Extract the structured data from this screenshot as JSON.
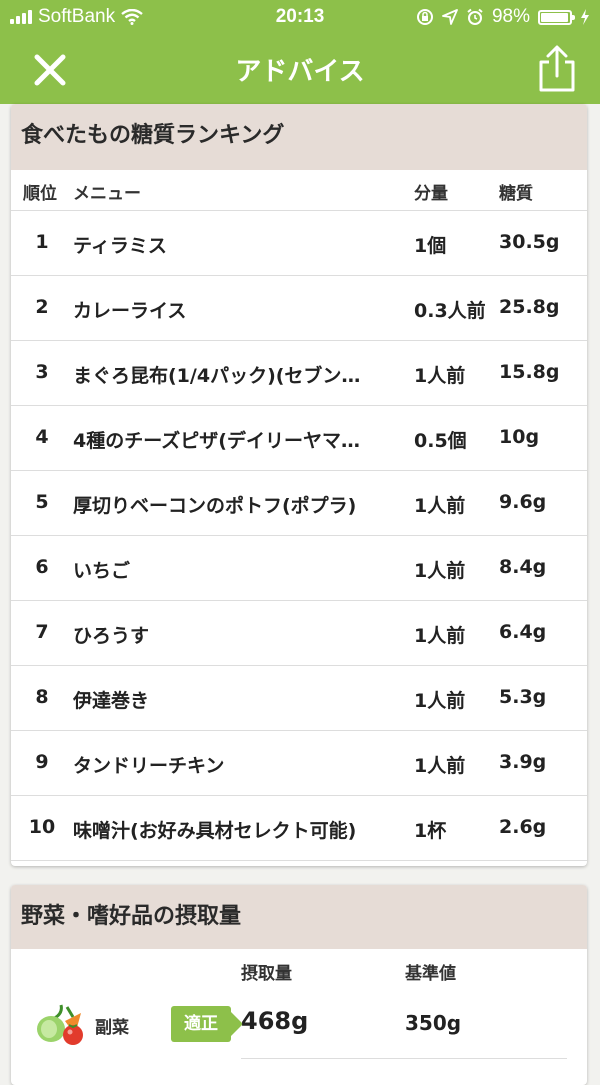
{
  "status": {
    "carrier": "SoftBank",
    "time": "20:13",
    "battery_text": "98%",
    "battery_level": 0.98
  },
  "nav": {
    "title": "アドバイス",
    "close_icon": "close-icon",
    "share_icon": "share-icon"
  },
  "ranking": {
    "title": "食べたもの糖質ランキング",
    "headers": {
      "rank": "順位",
      "menu": "メニュー",
      "qty": "分量",
      "carb": "糖質"
    },
    "rows": [
      {
        "rank": "1",
        "menu": "ティラミス",
        "qty": "1個",
        "carb": "30.5g"
      },
      {
        "rank": "2",
        "menu": "カレーライス",
        "qty": "0.3人前",
        "carb": "25.8g"
      },
      {
        "rank": "3",
        "menu": "まぐろ昆布(1/4パック)(セブン…",
        "qty": "1人前",
        "carb": "15.8g"
      },
      {
        "rank": "4",
        "menu": "4種のチーズピザ(デイリーヤマ…",
        "qty": "0.5個",
        "carb": "10g"
      },
      {
        "rank": "5",
        "menu": "厚切りベーコンのポトフ(ポプラ)",
        "qty": "1人前",
        "carb": "9.6g"
      },
      {
        "rank": "6",
        "menu": "いちご",
        "qty": "1人前",
        "carb": "8.4g"
      },
      {
        "rank": "7",
        "menu": "ひろうす",
        "qty": "1人前",
        "carb": "6.4g"
      },
      {
        "rank": "8",
        "menu": "伊達巻き",
        "qty": "1人前",
        "carb": "5.3g"
      },
      {
        "rank": "9",
        "menu": "タンドリーチキン",
        "qty": "1人前",
        "carb": "3.9g"
      },
      {
        "rank": "10",
        "menu": "味噌汁(お好み具材セレクト可能)",
        "qty": "1杯",
        "carb": "2.6g"
      }
    ]
  },
  "intake": {
    "title": "野菜・嗜好品の摂取量",
    "headers": {
      "amount": "摂取量",
      "standard": "基準値"
    },
    "rows": [
      {
        "icon": "vegetables-icon",
        "name": "副菜",
        "badge": "適正",
        "amount": "468g",
        "standard": "350g"
      }
    ]
  },
  "colors": {
    "accent": "#8dc04a",
    "header_bg": "#e6dcd6"
  }
}
